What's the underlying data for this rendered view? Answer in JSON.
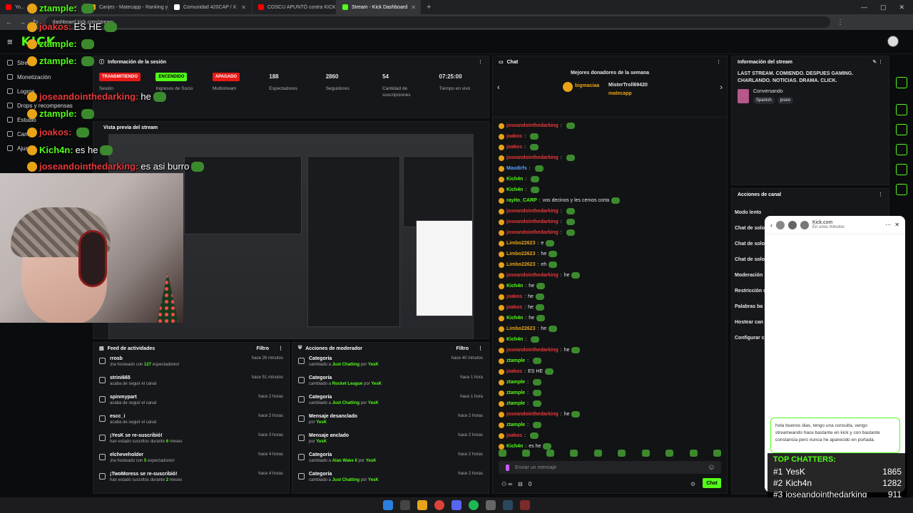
{
  "browser": {
    "tabs": [
      {
        "title": "Yo...",
        "color": "#ff0000"
      },
      {
        "title": "Canjes - Matecapp - Ranking y...",
        "color": "#e8a317"
      },
      {
        "title": "Comunidad 420CAP / X",
        "color": "#ffffff"
      },
      {
        "title": "COSCU APUNTÓ contra KICK tr...",
        "color": "#ff0000"
      },
      {
        "title": "Stream - Kick Dashboard",
        "color": "#53fc18",
        "active": true
      }
    ],
    "url": "dashboard.kick.com/stream"
  },
  "brand": {
    "logo": "KICK",
    "accent": "#53fc18"
  },
  "sidebar": {
    "items": [
      {
        "label": "Stream",
        "icon": "stream-icon"
      },
      {
        "label": "Monetización",
        "icon": "money-icon"
      },
      {
        "label": "Logros",
        "icon": "trophy-icon"
      },
      {
        "label": "Drops y recompensas",
        "icon": "gift-icon"
      },
      {
        "label": "Estudio",
        "icon": "studio-icon"
      },
      {
        "label": "Canal",
        "icon": "channel-icon"
      },
      {
        "label": "Ajustes",
        "icon": "gear-icon"
      }
    ]
  },
  "session": {
    "title": "Información de la sesión",
    "stats": [
      {
        "value": "TRANSMITIENDO",
        "label": "Sesión",
        "badge": "#e91916"
      },
      {
        "value": "ENCENDIDO",
        "label": "Ingresos de Socio",
        "badge": "#53fc18"
      },
      {
        "value": "APAGADO",
        "label": "Multistream",
        "badge": "#e91916"
      },
      {
        "value": "188",
        "label": "Espectadores"
      },
      {
        "value": "2860",
        "label": "Seguidores"
      },
      {
        "value": "54",
        "label": "Cantidad de suscripciones"
      },
      {
        "value": "07:25:00",
        "label": "Tiempo en vivo"
      }
    ]
  },
  "preview": {
    "title": "Vista previa del stream"
  },
  "activity": {
    "title": "Feed de actividades",
    "filter": "Filtro",
    "items": [
      {
        "name": "rrosb",
        "pre": "¡ha hosteado con ",
        "num": "127",
        "post": " espectadores!",
        "time": "hace 26 minutos",
        "icon": "host-icon"
      },
      {
        "name": "strini665",
        "pre": "acaba de seguir el canal",
        "num": "",
        "post": "",
        "time": "hace 51 minutos",
        "icon": "heart-icon"
      },
      {
        "name": "spinmypart",
        "pre": "acaba de seguir el canal",
        "num": "",
        "post": "",
        "time": "hace 2 horas",
        "icon": "heart-icon"
      },
      {
        "name": "escc_i",
        "pre": "acaba de seguir el canal",
        "num": "",
        "post": "",
        "time": "hace 2 horas",
        "icon": "heart-icon"
      },
      {
        "name": "¡YesK se re-suscribió!",
        "pre": "han estado suscritos durante ",
        "num": "6",
        "post": " meses",
        "time": "hace 3 horas",
        "icon": "star-icon"
      },
      {
        "name": "elcheveholder",
        "pre": "¡ha hosteado con ",
        "num": "5",
        "post": " espectadores!",
        "time": "hace 4 horas",
        "icon": "host-icon"
      },
      {
        "name": "¡TwoMoress se re-suscribió!",
        "pre": "han estado suscritos durante ",
        "num": "2",
        "post": " meses",
        "time": "hace 4 horas",
        "icon": "star-icon"
      }
    ]
  },
  "modactions": {
    "title": "Acciones de moderador",
    "filter": "Filtro",
    "items": [
      {
        "name": "Categoría",
        "pre": "cambiado a ",
        "target": "Just Chatting",
        "by": "YesK",
        "time": "hace 40 minutos",
        "icon": "category-icon"
      },
      {
        "name": "Categoría",
        "pre": "cambiado a ",
        "target": "Rocket League",
        "by": "YesK",
        "time": "hace 1 hora",
        "icon": "category-icon"
      },
      {
        "name": "Categoría",
        "pre": "cambiado a ",
        "target": "Just Chatting",
        "by": "YesK",
        "time": "hace 1 hora",
        "icon": "category-icon"
      },
      {
        "name": "Mensaje desanclado",
        "pre": "por ",
        "target": "YesK",
        "by": "",
        "time": "hace 2 horas",
        "icon": "unpin-icon"
      },
      {
        "name": "Mensaje anclado",
        "pre": "por ",
        "target": "YesK",
        "by": "",
        "time": "hace 2 horas",
        "icon": "pin-icon"
      },
      {
        "name": "Categoría",
        "pre": "cambiado a ",
        "target": "Alan Wake II",
        "by": "YesK",
        "time": "hace 2 horas",
        "icon": "category-icon"
      },
      {
        "name": "Categoría",
        "pre": "cambiado a ",
        "target": "Just Chatting",
        "by": "YesK",
        "time": "hace 2 horas",
        "icon": "category-icon"
      }
    ]
  },
  "chat": {
    "title": "Chat",
    "donors_title": "Mejores donadores de la semana",
    "donors": [
      "bigmaciaa",
      "MisterTroll69420",
      "matecapp"
    ],
    "messages": [
      {
        "user": "joseandointhedarking",
        "text": "",
        "color": "#e5393b"
      },
      {
        "user": "joakos",
        "text": "",
        "color": "#e5393b"
      },
      {
        "user": "joakos",
        "text": "",
        "color": "#e5393b"
      },
      {
        "user": "joseandointhedarking",
        "text": "",
        "color": "#e5393b"
      },
      {
        "user": "Maxdirfs",
        "text": "",
        "color": "#5aa0ff"
      },
      {
        "user": "Kich4n",
        "text": "",
        "color": "#53fc18"
      },
      {
        "user": "Kich4n",
        "text": "",
        "color": "#53fc18"
      },
      {
        "user": "rayito_CARP",
        "text": "vos decinos y les cemos corta",
        "color": "#53fc18"
      },
      {
        "user": "joseandointhedarking",
        "text": "",
        "color": "#e5393b"
      },
      {
        "user": "joseandointhedarking",
        "text": "",
        "color": "#e5393b"
      },
      {
        "user": "joseandointhedarking",
        "text": "",
        "color": "#e5393b"
      },
      {
        "user": "Limbo22623",
        "text": "e",
        "color": "#e8a317"
      },
      {
        "user": "Limbo22623",
        "text": "he",
        "color": "#e8a317"
      },
      {
        "user": "Limbo22623",
        "text": "eh",
        "color": "#e8a317"
      },
      {
        "user": "joseandointhedarking",
        "text": "he",
        "color": "#e5393b"
      },
      {
        "user": "Kich4n",
        "text": "he",
        "color": "#53fc18"
      },
      {
        "user": "joakos",
        "text": "he",
        "color": "#e5393b"
      },
      {
        "user": "joakos",
        "text": "he",
        "color": "#e5393b"
      },
      {
        "user": "Kich4n",
        "text": "he",
        "color": "#53fc18"
      },
      {
        "user": "Limbo22623",
        "text": "he",
        "color": "#e8a317"
      },
      {
        "user": "Kich4n",
        "text": "",
        "color": "#53fc18"
      },
      {
        "user": "joseandointhedarking",
        "text": "he",
        "color": "#e5393b"
      },
      {
        "user": "ztample",
        "text": "",
        "color": "#53fc18"
      },
      {
        "user": "joakos",
        "text": "ES HE",
        "color": "#e5393b"
      },
      {
        "user": "ztample",
        "text": "",
        "color": "#53fc18"
      },
      {
        "user": "ztample",
        "text": "",
        "color": "#53fc18"
      },
      {
        "user": "ztample",
        "text": "",
        "color": "#53fc18"
      },
      {
        "user": "joseandointhedarking",
        "text": "he",
        "color": "#e5393b"
      },
      {
        "user": "ztample",
        "text": "",
        "color": "#53fc18"
      },
      {
        "user": "joakos",
        "text": "",
        "color": "#e5393b"
      },
      {
        "user": "Kich4n",
        "text": "es he",
        "color": "#53fc18"
      },
      {
        "user": "joseandointhedarking",
        "text": "es asi burro",
        "color": "#e5393b"
      }
    ],
    "input_placeholder": "Enviar un mensaje",
    "send_label": "Chat",
    "points": "0"
  },
  "streaminfo": {
    "title": "Información del stream",
    "stream_title": "LAST STREAM. COMIENDO. DESPUES GAMING. CHARLANDO. NOTICIAS. DRAMA. CLICK.",
    "category": "Conversando",
    "tags": [
      "Spanish",
      "joseo"
    ]
  },
  "channel_actions": {
    "title": "Acciones de canal",
    "items": [
      "Modo lento",
      "Chat de solo",
      "Chat de solo",
      "Chat de solo",
      "Moderación",
      "Restricción c",
      "Palabras ba",
      "Hostear can",
      "Configurar c"
    ]
  },
  "popup": {
    "site": "Kick.com",
    "status": "En unos minutos",
    "message": "hola buenos dias, tengo una consulta, vengo streameando hace bastante en kick y con bastante constancia pero nunca he aparecido en portada."
  },
  "top_chatters": {
    "title": "TOP CHATTERS:",
    "rows": [
      {
        "rank": "#1",
        "name": "YesK",
        "count": "1865"
      },
      {
        "rank": "#2",
        "name": "Kich4n",
        "count": "1282"
      },
      {
        "rank": "#3",
        "name": "joseandointhedarking",
        "count": "911"
      }
    ]
  },
  "overlay_chat": [
    {
      "user": "ztample:",
      "text": "",
      "color": "#53fc18"
    },
    {
      "user": "joakos:",
      "text": "ES HE",
      "color": "#e5393b"
    },
    {
      "user": "ztample:",
      "text": "",
      "color": "#53fc18"
    },
    {
      "user": "ztample:",
      "text": "",
      "color": "#53fc18"
    },
    {
      "user": "joseandointhedarking:",
      "text": "he",
      "color": "#e5393b"
    },
    {
      "user": "ztample:",
      "text": "",
      "color": "#53fc18"
    },
    {
      "user": "joakos:",
      "text": "",
      "color": "#e5393b"
    },
    {
      "user": "Kich4n:",
      "text": "es he",
      "color": "#53fc18"
    },
    {
      "user": "joseandointhedarking:",
      "text": "es asi burro",
      "color": "#e5393b"
    }
  ]
}
